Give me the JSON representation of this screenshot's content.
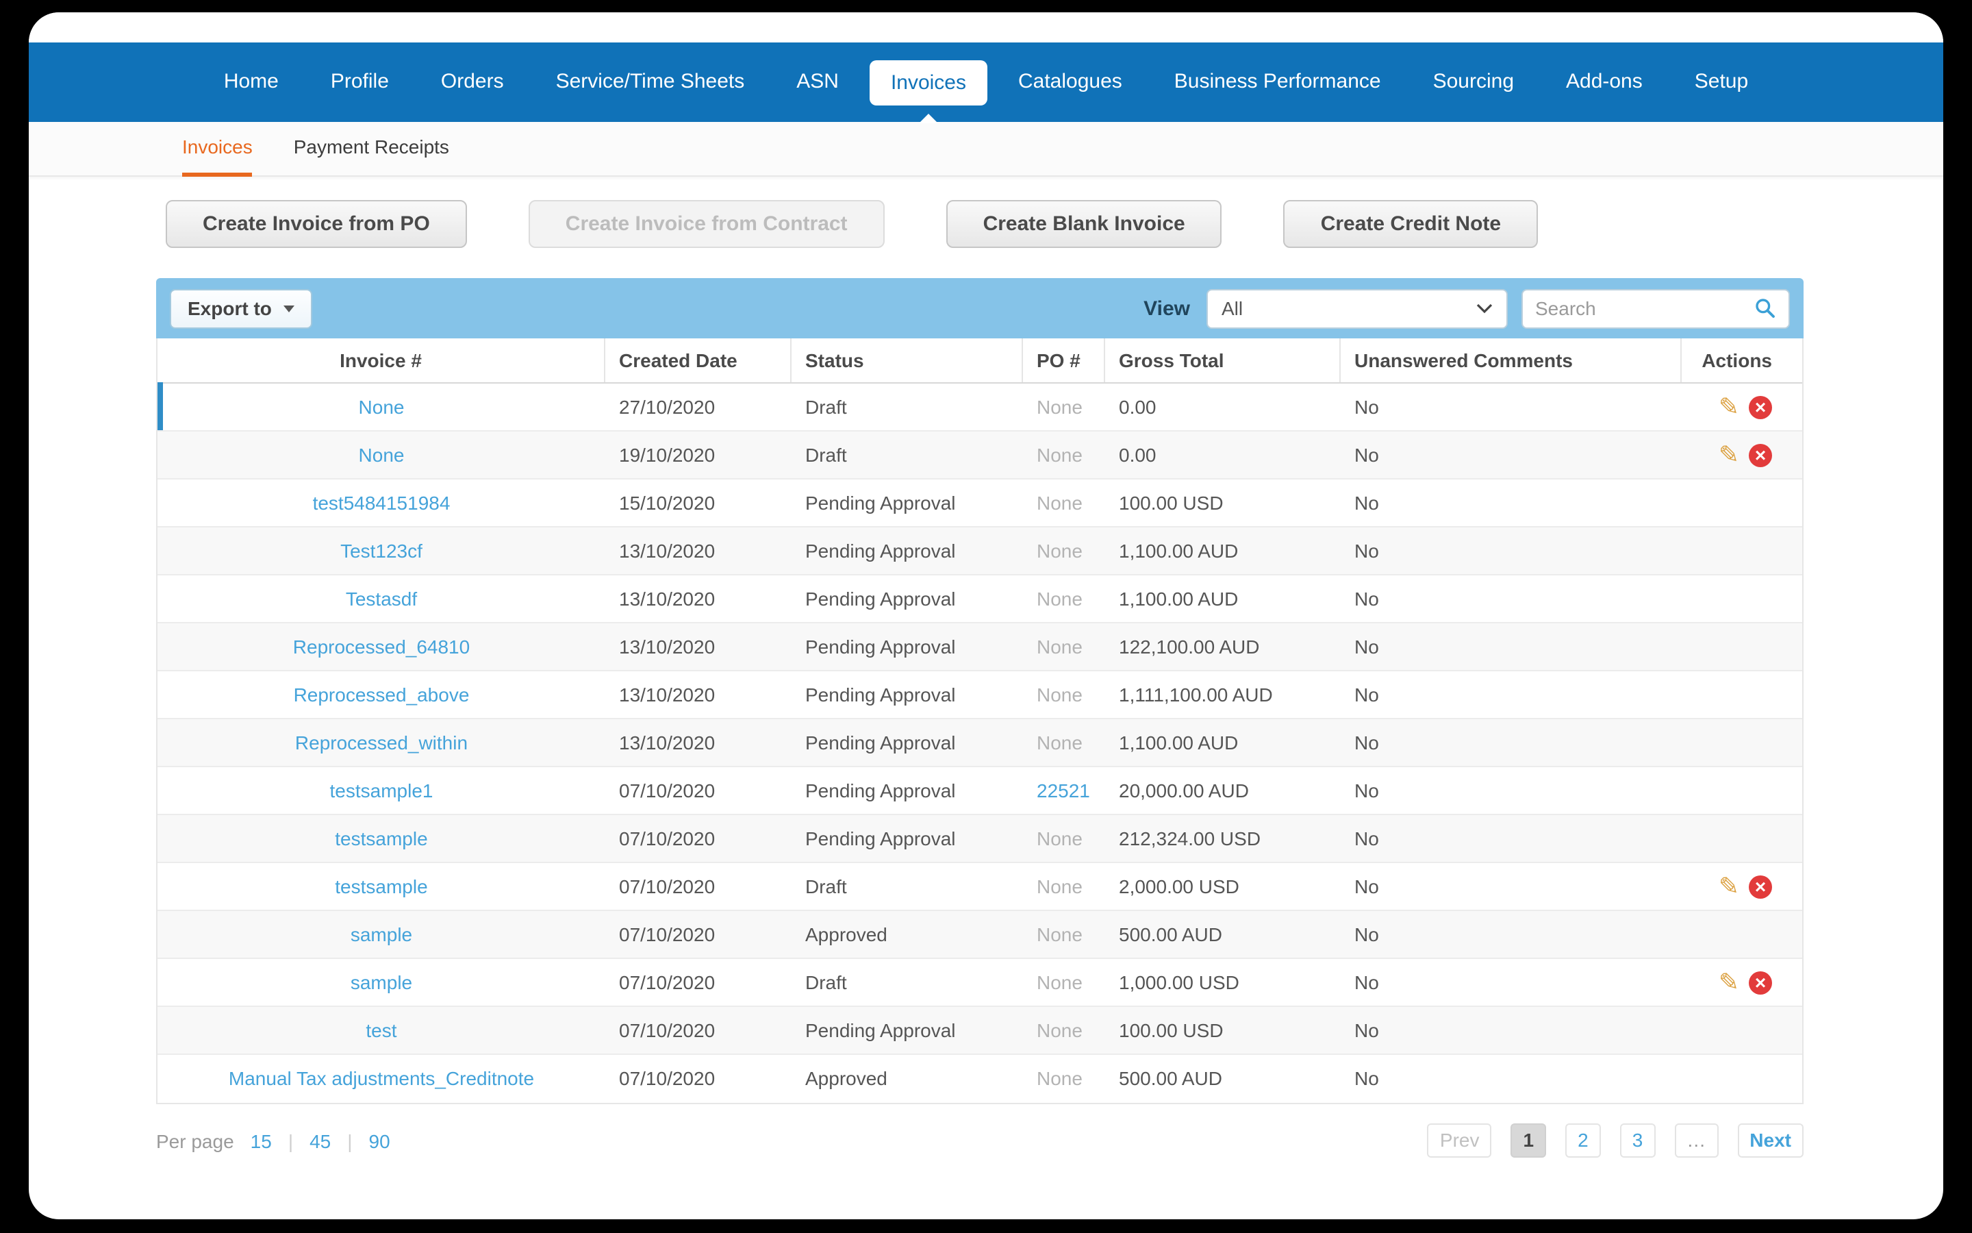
{
  "nav": {
    "items": [
      "Home",
      "Profile",
      "Orders",
      "Service/Time Sheets",
      "ASN",
      "Invoices",
      "Catalogues",
      "Business Performance",
      "Sourcing",
      "Add-ons",
      "Setup"
    ],
    "active_index": 5
  },
  "subnav": {
    "items": [
      {
        "label": "Invoices",
        "active": true
      },
      {
        "label": "Payment Receipts",
        "active": false
      }
    ]
  },
  "action_buttons": [
    {
      "label": "Create Invoice from PO",
      "disabled": false
    },
    {
      "label": "Create Invoice from Contract",
      "disabled": true
    },
    {
      "label": "Create Blank Invoice",
      "disabled": false
    },
    {
      "label": "Create Credit Note",
      "disabled": false
    }
  ],
  "toolbar": {
    "export_label": "Export to",
    "view_label": "View",
    "view_value": "All",
    "search_placeholder": "Search"
  },
  "table": {
    "columns": [
      "Invoice #",
      "Created Date",
      "Status",
      "PO #",
      "Gross Total",
      "Unanswered Comments",
      "Actions"
    ],
    "rows": [
      {
        "invoice": "None",
        "created": "27/10/2020",
        "status": "Draft",
        "po": "None",
        "po_is_link": false,
        "gross": "0.00",
        "comments": "No",
        "has_actions": true,
        "selected": true
      },
      {
        "invoice": "None",
        "created": "19/10/2020",
        "status": "Draft",
        "po": "None",
        "po_is_link": false,
        "gross": "0.00",
        "comments": "No",
        "has_actions": true,
        "selected": false
      },
      {
        "invoice": "test5484151984",
        "created": "15/10/2020",
        "status": "Pending Approval",
        "po": "None",
        "po_is_link": false,
        "gross": "100.00 USD",
        "comments": "No",
        "has_actions": false,
        "selected": false
      },
      {
        "invoice": "Test123cf",
        "created": "13/10/2020",
        "status": "Pending Approval",
        "po": "None",
        "po_is_link": false,
        "gross": "1,100.00 AUD",
        "comments": "No",
        "has_actions": false,
        "selected": false
      },
      {
        "invoice": "Testasdf",
        "created": "13/10/2020",
        "status": "Pending Approval",
        "po": "None",
        "po_is_link": false,
        "gross": "1,100.00 AUD",
        "comments": "No",
        "has_actions": false,
        "selected": false
      },
      {
        "invoice": "Reprocessed_64810",
        "created": "13/10/2020",
        "status": "Pending Approval",
        "po": "None",
        "po_is_link": false,
        "gross": "122,100.00 AUD",
        "comments": "No",
        "has_actions": false,
        "selected": false
      },
      {
        "invoice": "Reprocessed_above",
        "created": "13/10/2020",
        "status": "Pending Approval",
        "po": "None",
        "po_is_link": false,
        "gross": "1,111,100.00 AUD",
        "comments": "No",
        "has_actions": false,
        "selected": false
      },
      {
        "invoice": "Reprocessed_within",
        "created": "13/10/2020",
        "status": "Pending Approval",
        "po": "None",
        "po_is_link": false,
        "gross": "1,100.00 AUD",
        "comments": "No",
        "has_actions": false,
        "selected": false
      },
      {
        "invoice": "testsample1",
        "created": "07/10/2020",
        "status": "Pending Approval",
        "po": "22521",
        "po_is_link": true,
        "gross": "20,000.00 AUD",
        "comments": "No",
        "has_actions": false,
        "selected": false
      },
      {
        "invoice": "testsample",
        "created": "07/10/2020",
        "status": "Pending Approval",
        "po": "None",
        "po_is_link": false,
        "gross": "212,324.00 USD",
        "comments": "No",
        "has_actions": false,
        "selected": false
      },
      {
        "invoice": "testsample",
        "created": "07/10/2020",
        "status": "Draft",
        "po": "None",
        "po_is_link": false,
        "gross": "2,000.00 USD",
        "comments": "No",
        "has_actions": true,
        "selected": false
      },
      {
        "invoice": "sample",
        "created": "07/10/2020",
        "status": "Approved",
        "po": "None",
        "po_is_link": false,
        "gross": "500.00 AUD",
        "comments": "No",
        "has_actions": false,
        "selected": false
      },
      {
        "invoice": "sample",
        "created": "07/10/2020",
        "status": "Draft",
        "po": "None",
        "po_is_link": false,
        "gross": "1,000.00 USD",
        "comments": "No",
        "has_actions": true,
        "selected": false
      },
      {
        "invoice": "test",
        "created": "07/10/2020",
        "status": "Pending Approval",
        "po": "None",
        "po_is_link": false,
        "gross": "100.00 USD",
        "comments": "No",
        "has_actions": false,
        "selected": false
      },
      {
        "invoice": "Manual Tax adjustments_Creditnote",
        "created": "07/10/2020",
        "status": "Approved",
        "po": "None",
        "po_is_link": false,
        "gross": "500.00 AUD",
        "comments": "No",
        "has_actions": false,
        "selected": false
      }
    ]
  },
  "footer": {
    "per_page_label": "Per page",
    "per_page_options": [
      "15",
      "45",
      "90"
    ],
    "pagination": {
      "prev": "Prev",
      "pages": [
        "1",
        "2",
        "3"
      ],
      "current": "1",
      "ellipsis": "…",
      "next": "Next"
    }
  },
  "icons": {
    "pencil": "✎",
    "delete_x": "×"
  },
  "colors": {
    "nav_blue": "#1072b8",
    "toolbar_blue": "#85c3e8",
    "link_blue": "#45a3da",
    "accent_orange": "#e8681f",
    "delete_red": "#e23b3b",
    "pencil_orange": "#dca141",
    "selected_row_accent": "#2f8dc7"
  }
}
